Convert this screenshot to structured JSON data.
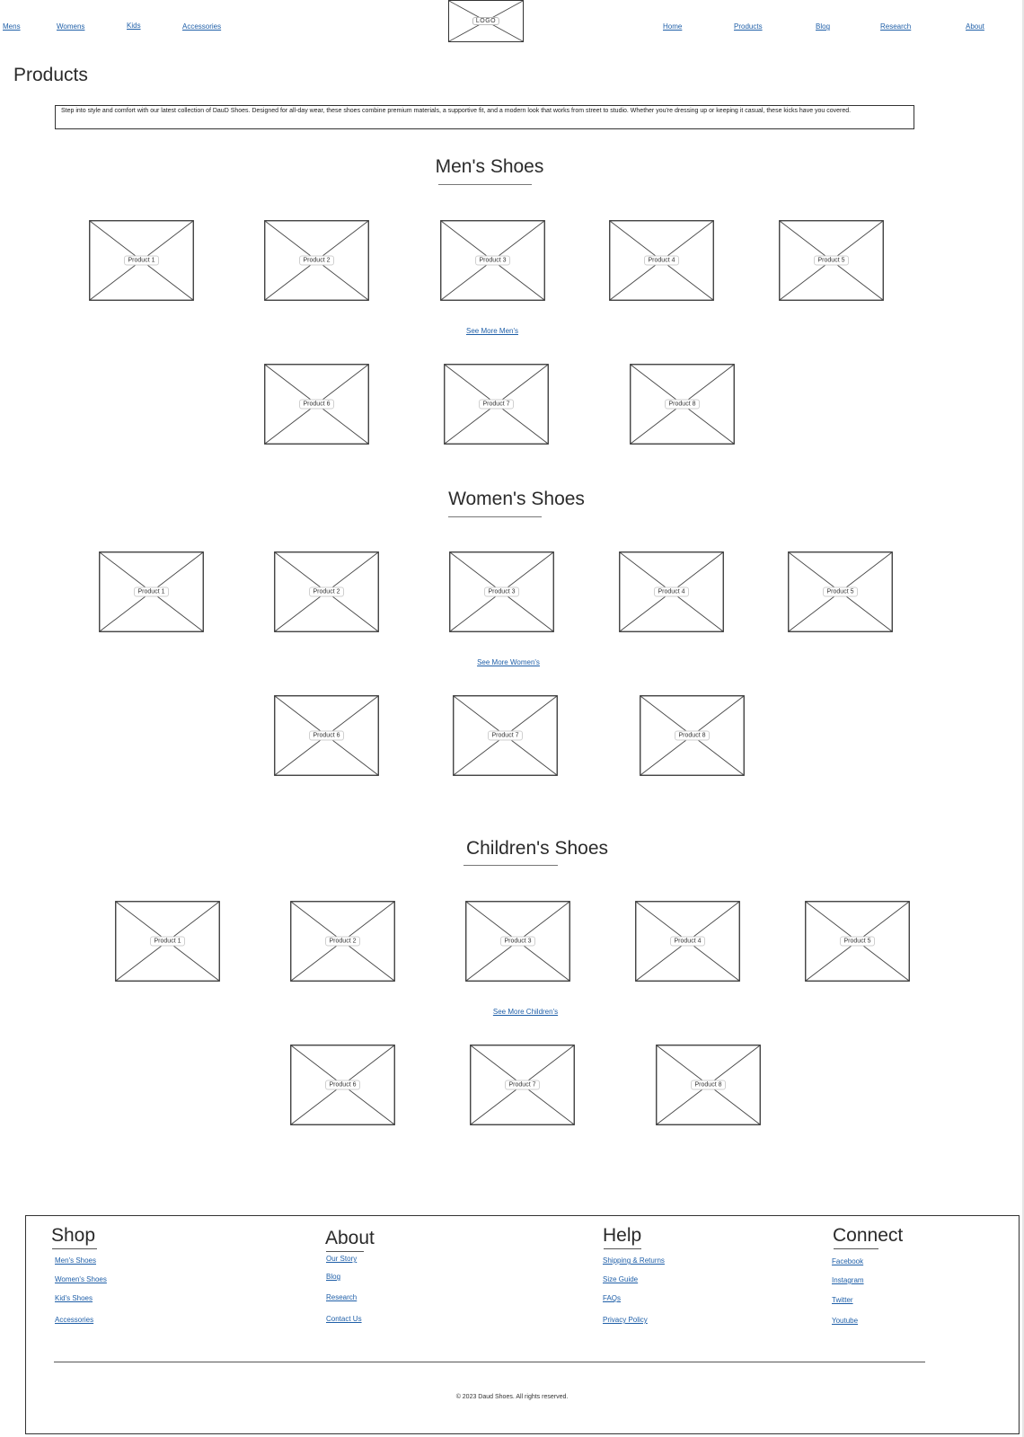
{
  "nav": {
    "left": [
      "Mens",
      "Womens",
      "Kids",
      "Accessories"
    ],
    "logo": "LOGO",
    "right": [
      "Home",
      "Products",
      "Blog",
      "Research",
      "About"
    ]
  },
  "page": {
    "title": "Products",
    "intro": "Step into style and comfort with our latest collection of DauD Shoes. Designed for all-day wear, these shoes combine premium materials, a supportive fit, and a modern look that works from street to studio. Whether you're dressing up or keeping it casual, these kicks have you covered."
  },
  "sections": [
    {
      "title": "Men's Shoes",
      "see_more": "See More Men's",
      "products": [
        "Product 1",
        "Product 2",
        "Product 3",
        "Product 4",
        "Product 5",
        "Product 6",
        "Product 7",
        "Product 8"
      ]
    },
    {
      "title": "Women's Shoes",
      "see_more": "See More Women's",
      "products": [
        "Product 1",
        "Product 2",
        "Product 3",
        "Product 4",
        "Product 5",
        "Product 6",
        "Product 7",
        "Product 8"
      ]
    },
    {
      "title": "Children's Shoes",
      "see_more": "See More Children's",
      "products": [
        "Product 1",
        "Product 2",
        "Product 3",
        "Product 4",
        "Product 5",
        "Product 6",
        "Product 7",
        "Product 8"
      ]
    }
  ],
  "footer": {
    "columns": [
      {
        "heading": "Shop",
        "links": [
          "Men's Shoes",
          "Women's Shoes",
          "Kid's Shoes",
          "Accessories"
        ]
      },
      {
        "heading": "About",
        "links": [
          "Our Story",
          "Blog",
          "Research",
          "Contact Us"
        ]
      },
      {
        "heading": "Help",
        "links": [
          "Shipping & Returns",
          "Size Guide",
          "FAQs",
          "Privacy Policy"
        ]
      },
      {
        "heading": "Connect",
        "links": [
          "Facebook",
          "Instagram",
          "Twitter",
          "Youtube"
        ]
      }
    ],
    "copyright": "© 2023 Daud Shoes. All rights reserved."
  },
  "colors": {
    "link": "#1f5fa8",
    "stroke": "#333333"
  }
}
